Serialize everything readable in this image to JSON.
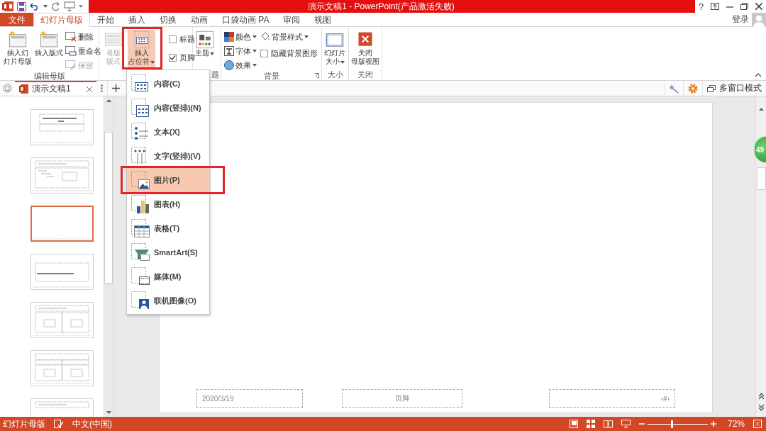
{
  "window": {
    "title": "演示文稿1 - PowerPoint(产品激活失败)",
    "help": "?"
  },
  "ribbon_tabs": [
    {
      "label": "文件",
      "kind": "file",
      "selected": false
    },
    {
      "label": "幻灯片母版",
      "kind": "tab",
      "selected": true
    },
    {
      "label": "开始",
      "kind": "tab",
      "selected": false
    },
    {
      "label": "插入",
      "kind": "tab",
      "selected": false
    },
    {
      "label": "切换",
      "kind": "tab",
      "selected": false
    },
    {
      "label": "动画",
      "kind": "tab",
      "selected": false
    },
    {
      "label": "口袋动画 PA",
      "kind": "tab",
      "selected": false
    },
    {
      "label": "审阅",
      "kind": "tab",
      "selected": false
    },
    {
      "label": "视图",
      "kind": "tab",
      "selected": false
    }
  ],
  "account": {
    "label": "登录"
  },
  "ribbon_groups": [
    {
      "label": "编辑母版",
      "items": [
        {
          "kind": "large",
          "lines": [
            "插入幻",
            "灯片母版"
          ]
        },
        {
          "kind": "large",
          "lines": [
            "插入版式"
          ]
        },
        {
          "kind": "stack",
          "items": [
            {
              "kind": "small",
              "label": "删除",
              "disabled": false
            },
            {
              "kind": "small",
              "label": "重命名",
              "disabled": false
            },
            {
              "kind": "small",
              "label": "保留",
              "disabled": true
            }
          ]
        }
      ]
    },
    {
      "items": [
        {
          "kind": "large",
          "lines": [
            "母版",
            "版式"
          ],
          "disabled": true
        },
        {
          "kind": "large",
          "lines": [
            "插入",
            "占位符"
          ],
          "dropdown": true,
          "pressed": true
        },
        {
          "kind": "stack",
          "items": [
            {
              "kind": "check",
              "label": "标题",
              "checked": false
            },
            {
              "kind": "check",
              "label": "页脚",
              "checked": true
            }
          ]
        }
      ]
    },
    {
      "label": "题",
      "items": [
        {
          "kind": "large",
          "lines": [
            "主题"
          ],
          "dropdown": true
        }
      ]
    },
    {
      "label": "背景",
      "launcher": true,
      "items": [
        {
          "kind": "stack",
          "items": [
            {
              "kind": "small",
              "label": "颜色",
              "dropdown": true
            },
            {
              "kind": "small",
              "label": "字体",
              "dropdown": true
            },
            {
              "kind": "small",
              "label": "效果",
              "dropdown": true
            }
          ]
        },
        {
          "kind": "stack",
          "items": [
            {
              "kind": "small",
              "label": "背景样式",
              "dropdown": true
            },
            {
              "kind": "check",
              "label": "隐藏背景图形",
              "checked": false
            }
          ]
        }
      ]
    },
    {
      "label": "大小",
      "items": [
        {
          "kind": "large",
          "lines": [
            "幻灯片",
            "大小"
          ],
          "dropdown": true
        }
      ]
    },
    {
      "label": "关闭",
      "items": [
        {
          "kind": "large",
          "lines": [
            "关闭",
            "母版视图"
          ]
        }
      ]
    }
  ],
  "doc_tabs": {
    "tab": "演示文稿1",
    "multi_window": "多窗口模式"
  },
  "thumbnails": [
    {
      "kind": "title",
      "selected": false
    },
    {
      "kind": "content",
      "selected": false
    },
    {
      "kind": "blank",
      "selected": true
    },
    {
      "kind": "section",
      "selected": false
    },
    {
      "kind": "two",
      "selected": false
    },
    {
      "kind": "compare",
      "selected": false
    },
    {
      "kind": "titleonly",
      "selected": false
    }
  ],
  "slide": {
    "date": "2020/3/19",
    "footer": "页脚",
    "number": "‹#›"
  },
  "badge": {
    "label": "49"
  },
  "placeholder_menu": {
    "items": [
      {
        "kind": "content",
        "label": "内容(C)",
        "selected": false
      },
      {
        "kind": "content_vertical",
        "label": "内容(竖排)(N)",
        "selected": false
      },
      {
        "kind": "text",
        "label": "文本(X)",
        "selected": false
      },
      {
        "kind": "text_vertical",
        "label": "文字(竖排)(V)",
        "selected": false
      },
      {
        "kind": "picture",
        "label": "图片(P)",
        "selected": true
      },
      {
        "kind": "chart",
        "label": "图表(H)",
        "selected": false
      },
      {
        "kind": "table",
        "label": "表格(T)",
        "selected": false
      },
      {
        "kind": "smartart",
        "label": "SmartArt(S)",
        "selected": false
      },
      {
        "kind": "media",
        "label": "媒体(M)",
        "selected": false
      },
      {
        "kind": "online_image",
        "label": "联机图像(O)",
        "selected": false
      }
    ]
  },
  "status_bar": {
    "view": "幻灯片母版",
    "language": "中文(中国)",
    "zoom": {
      "label": "72%",
      "level": 0.4
    }
  }
}
